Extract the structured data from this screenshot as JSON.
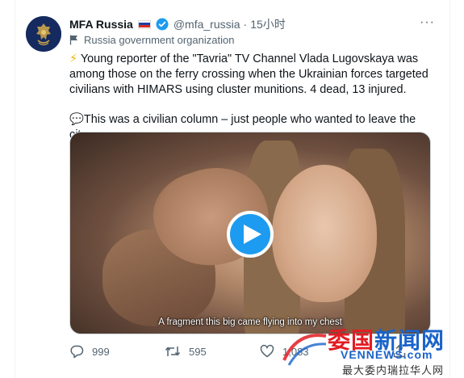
{
  "account": {
    "name": "MFA Russia",
    "handle": "@mfa_russia",
    "separator": "·",
    "time": "15小时",
    "label": "Russia government organization",
    "more": "···"
  },
  "tweet": {
    "emoji1": "⚡",
    "line1": " Young reporter of the \"Tavria\" TV Channel Vlada Lugovskaya was among those on the ferry crossing when the Ukrainian forces targeted civilians with HIMARS using cluster munitions. 4 dead, 13 injured.",
    "emoji2": "💬",
    "line2": "This was a civilian column – just people who wanted to leave the city."
  },
  "media": {
    "caption": "A fragment this big came flying into my chest"
  },
  "actions": {
    "replies": "999",
    "retweets": "595",
    "likes": "1,083"
  },
  "watermark": {
    "top_red": "委国",
    "top_blue": "新闻网",
    "middle": "VENNEWS.com",
    "bottom": "最大委内瑞拉华人网"
  },
  "colors": {
    "accent": "#1d9bf0",
    "muted": "#536471",
    "watermark_red": "#e21c23",
    "watermark_blue": "#1a63c9"
  }
}
